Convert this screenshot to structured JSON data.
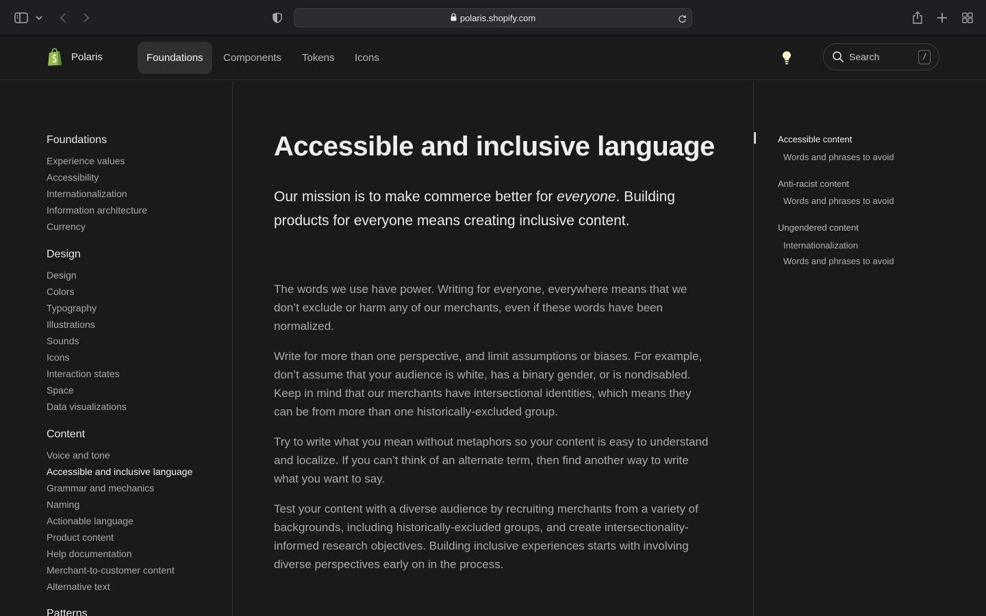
{
  "browser": {
    "url": "polaris.shopify.com"
  },
  "header": {
    "brand": "Polaris",
    "nav": [
      "Foundations",
      "Components",
      "Tokens",
      "Icons"
    ],
    "search": {
      "label": "Search",
      "shortcut": "/"
    }
  },
  "sidebar": {
    "sections": [
      {
        "title": "Foundations",
        "items": [
          "Experience values",
          "Accessibility",
          "Internationalization",
          "Information architecture",
          "Currency"
        ]
      },
      {
        "title": "Design",
        "items": [
          "Design",
          "Colors",
          "Typography",
          "Illustrations",
          "Sounds",
          "Icons",
          "Interaction states",
          "Space",
          "Data visualizations"
        ]
      },
      {
        "title": "Content",
        "items": [
          "Voice and tone",
          "Accessible and inclusive language",
          "Grammar and mechanics",
          "Naming",
          "Actionable language",
          "Product content",
          "Help documentation",
          "Merchant-to-customer content",
          "Alternative text"
        ]
      },
      {
        "title": "Patterns",
        "items": []
      }
    ],
    "current": "Accessible and inclusive language"
  },
  "main": {
    "title": "Accessible and inclusive language",
    "lead_before": "Our mission is to make commerce better for ",
    "lead_em": "everyone",
    "lead_after": ". Building products for everyone means creating inclusive content.",
    "paragraphs": [
      "The words we use have power. Writing for everyone, everywhere means that we don’t exclude or harm any of our merchants, even if these words have been normalized.",
      "Write for more than one perspective, and limit assumptions or biases. For example, don’t assume that your audience is white, has a binary gender, or is nondisabled. Keep in mind that our merchants have intersectional identities, which means they can be from more than one historically-excluded group.",
      "Try to write what you mean without metaphors so your content is easy to understand and localize. If you can’t think of an alternate term, then find another way to write what you want to say.",
      "Test your content with a diverse audience by recruiting merchants from a variety of backgrounds, including historically-excluded groups, and create intersectionality-informed research objectives. Building inclusive experiences starts with involving diverse perspectives early on in the process."
    ]
  },
  "toc": {
    "groups": [
      {
        "label": "Accessible content",
        "children": [
          "Words and phrases to avoid"
        ]
      },
      {
        "label": "Anti-racist content",
        "children": [
          "Words and phrases to avoid"
        ]
      },
      {
        "label": "Ungendered content",
        "children": [
          "Internationalization",
          "Words and phrases to avoid"
        ]
      }
    ]
  }
}
